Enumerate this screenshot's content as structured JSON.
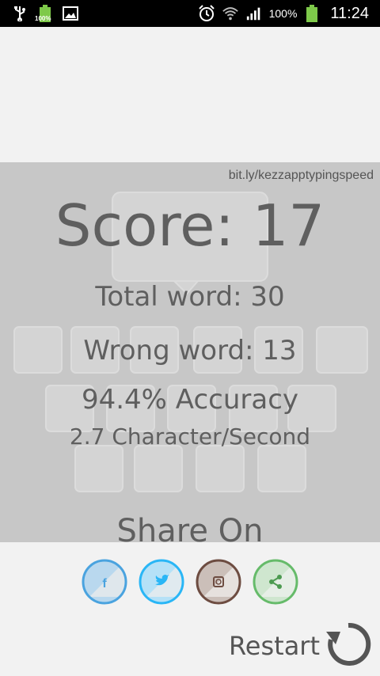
{
  "status_bar": {
    "battery_small_label": "100%",
    "battery_percent": "100%",
    "time": "11:24"
  },
  "results": {
    "url": "bit.ly/kezzapptypingspeed",
    "score": "Score: 17",
    "total_word": "Total word: 30",
    "wrong_word": "Wrong word: 13",
    "accuracy": "94.4% Accuracy",
    "char_per_second": "2.7 Character/Second"
  },
  "share": {
    "title": "Share On",
    "buttons": [
      {
        "name": "facebook",
        "icon": "facebook-icon",
        "color": "#4aa3df"
      },
      {
        "name": "twitter",
        "icon": "twitter-icon",
        "color": "#29b6f6"
      },
      {
        "name": "instagram",
        "icon": "instagram-icon",
        "color": "#6d4c41"
      },
      {
        "name": "share",
        "icon": "share-icon",
        "color": "#66bb6a"
      }
    ]
  },
  "restart": {
    "label": "Restart",
    "icon": "restart-icon"
  }
}
